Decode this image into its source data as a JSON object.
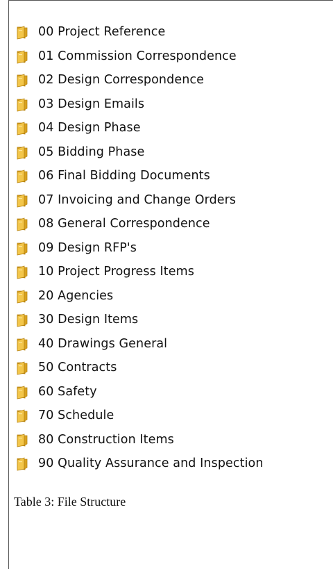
{
  "folders": [
    {
      "label": "00 Project Reference",
      "icon": "folder-icon"
    },
    {
      "label": "01 Commission Correspondence",
      "icon": "folder-icon"
    },
    {
      "label": "02 Design Correspondence",
      "icon": "folder-icon"
    },
    {
      "label": "03 Design Emails",
      "icon": "folder-icon"
    },
    {
      "label": "04 Design Phase",
      "icon": "folder-icon"
    },
    {
      "label": "05 Bidding Phase",
      "icon": "folder-icon"
    },
    {
      "label": "06 Final Bidding Documents",
      "icon": "folder-icon"
    },
    {
      "label": "07 Invoicing and Change Orders",
      "icon": "folder-icon"
    },
    {
      "label": "08 General Correspondence",
      "icon": "folder-icon"
    },
    {
      "label": "09 Design RFP's",
      "icon": "folder-icon"
    },
    {
      "label": "10 Project Progress Items",
      "icon": "folder-icon"
    },
    {
      "label": "20 Agencies",
      "icon": "folder-icon"
    },
    {
      "label": "30 Design  Items",
      "icon": "folder-icon"
    },
    {
      "label": "40 Drawings General",
      "icon": "folder-icon"
    },
    {
      "label": "50 Contracts",
      "icon": "folder-icon"
    },
    {
      "label": "60 Safety",
      "icon": "folder-icon"
    },
    {
      "label": "70 Schedule",
      "icon": "folder-icon"
    },
    {
      "label": "80 Construction Items",
      "icon": "folder-icon"
    },
    {
      "label": "90 Quality Assurance and Inspection",
      "icon": "folder-icon"
    }
  ],
  "caption": "Table 3: File Structure",
  "colors": {
    "folder_front": "#f3c64a",
    "folder_back": "#d9a21f",
    "folder_edge": "#b88410",
    "frame_border": "#555555"
  }
}
